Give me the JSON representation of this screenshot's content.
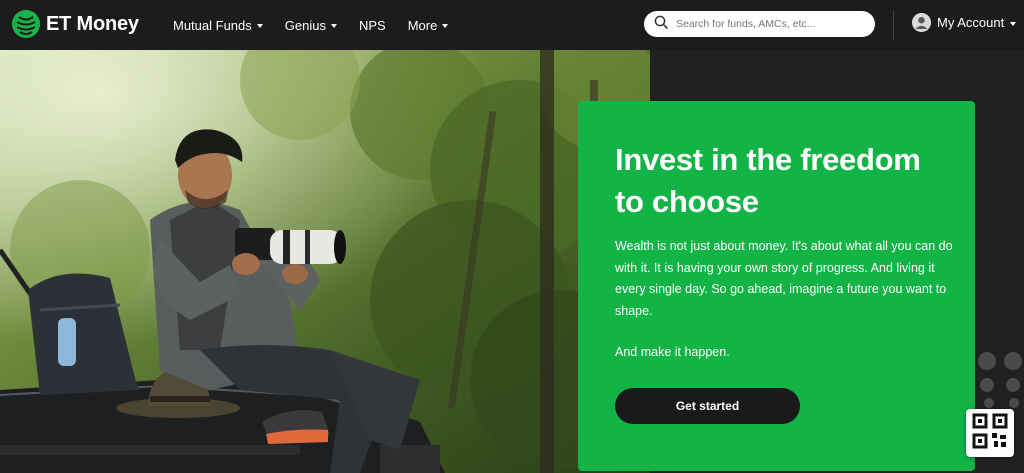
{
  "header": {
    "brand": "ET Money",
    "nav_items": [
      {
        "label": "Mutual Funds",
        "has_dropdown": true
      },
      {
        "label": "Genius",
        "has_dropdown": true
      },
      {
        "label": "NPS",
        "has_dropdown": false
      },
      {
        "label": "More",
        "has_dropdown": true
      }
    ],
    "search": {
      "placeholder": "Search for funds, AMCs, etc...",
      "value": ""
    },
    "account": {
      "label": "My Account",
      "icon": "user-avatar-icon"
    }
  },
  "hero": {
    "title": "Invest in the freedom to choose",
    "body": "Wealth is not just about money. It's about what all you can do with it. It is having your own story of progress. And living it every single day. So go ahead, imagine a future you want to shape.",
    "tagline": "And make it happen.",
    "cta_label": "Get started",
    "image": "photographer-on-car-photo"
  },
  "floating": {
    "qr_icon": "qr-code-icon"
  },
  "colors": {
    "nav_bg": "#1c1c1c",
    "brand_green": "#12b446",
    "cta_bg": "#1a1a1a",
    "text_light": "#ffffff"
  }
}
